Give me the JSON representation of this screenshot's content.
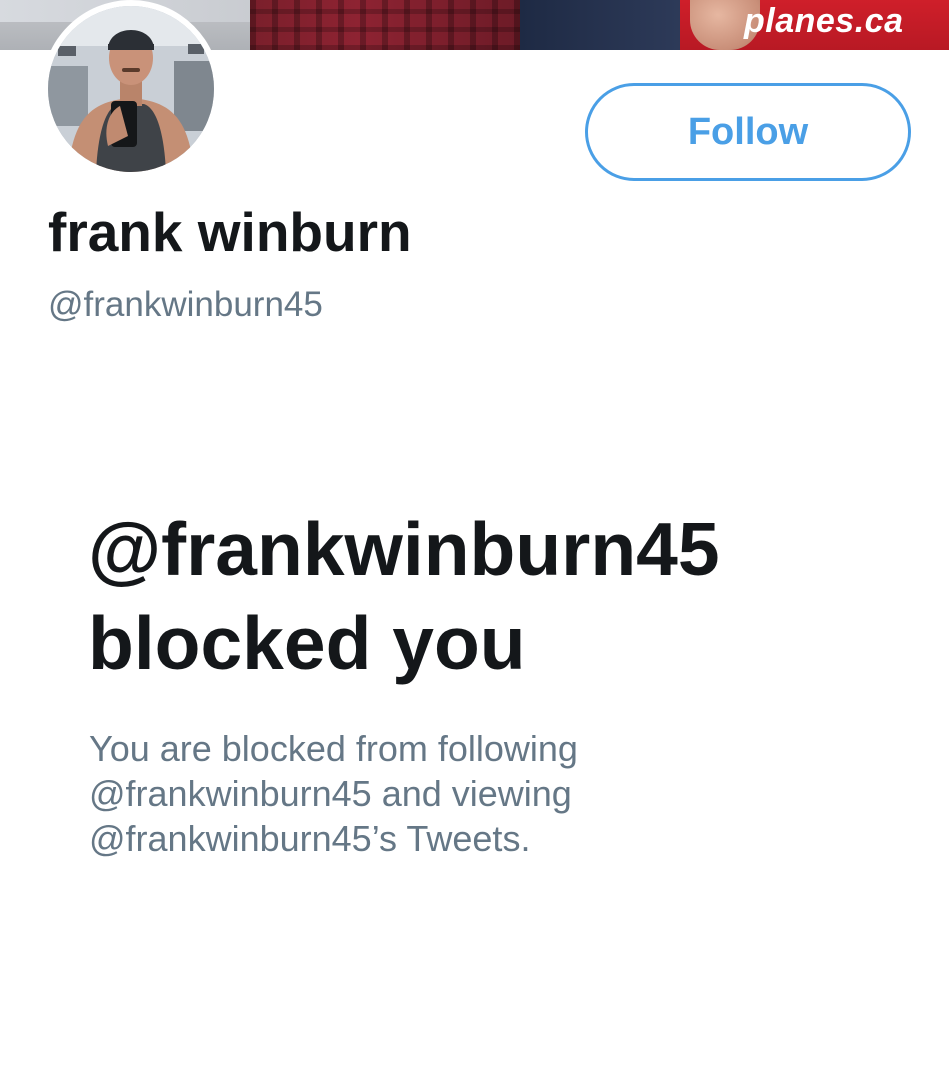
{
  "banner": {
    "sign_text": "planes.ca"
  },
  "profile": {
    "display_name": "frank winburn",
    "handle": "@frankwinburn45",
    "avatar_icon": "profile-photo"
  },
  "actions": {
    "follow_label": "Follow"
  },
  "blocked_notice": {
    "title_line1": "@frankwinburn45",
    "title_line2": "blocked you",
    "desc_line1": "You are blocked from following",
    "desc_line2": "@frankwinburn45 and viewing",
    "desc_line3": "@frankwinburn45’s Tweets."
  },
  "colors": {
    "accent": "#4a9fe6",
    "text_primary": "#14171a",
    "text_secondary": "#657786",
    "background": "#ffffff"
  }
}
